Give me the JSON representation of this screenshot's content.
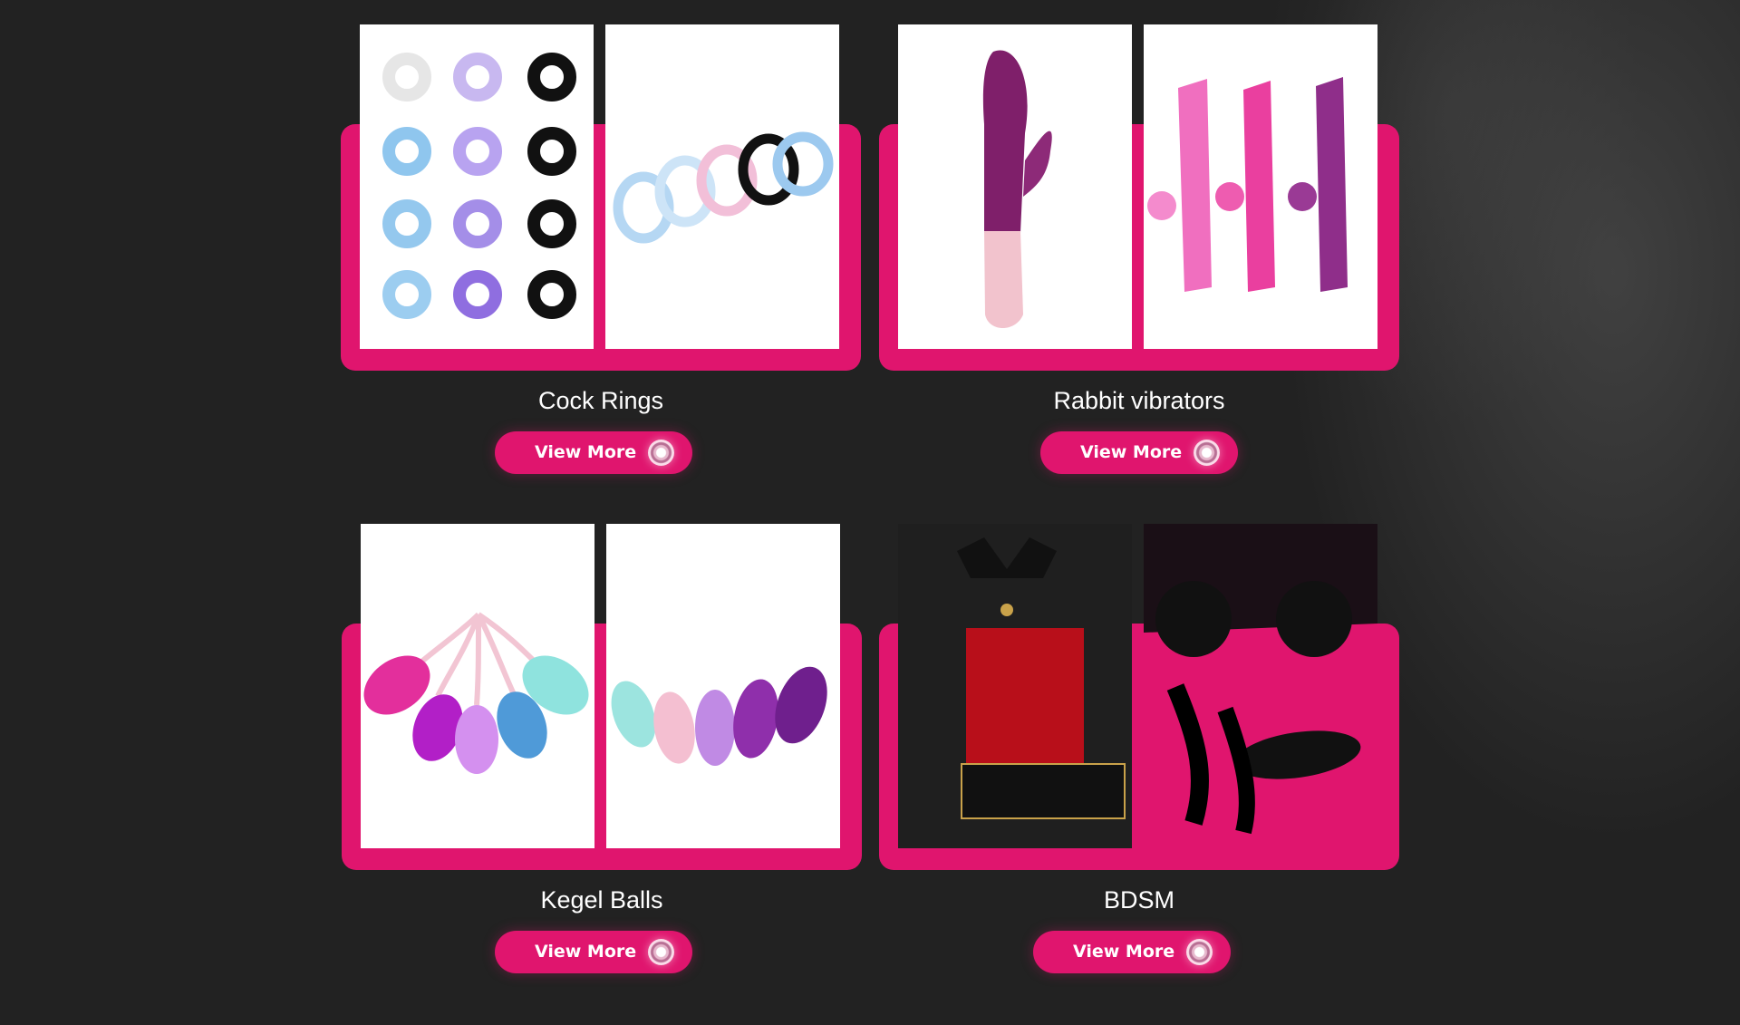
{
  "categories": [
    {
      "title": "Cock Rings",
      "button": "View More"
    },
    {
      "title": "Rabbit vibrators",
      "button": "View More"
    },
    {
      "title": "Kegel Balls",
      "button": "View More"
    },
    {
      "title": "BDSM",
      "button": "View More"
    }
  ],
  "colors": {
    "background": "#222222",
    "accent": "#e0156e",
    "panel": "#ffffff",
    "text": "#ffffff"
  },
  "icons": {
    "button_icon": "target-ring-icon"
  }
}
